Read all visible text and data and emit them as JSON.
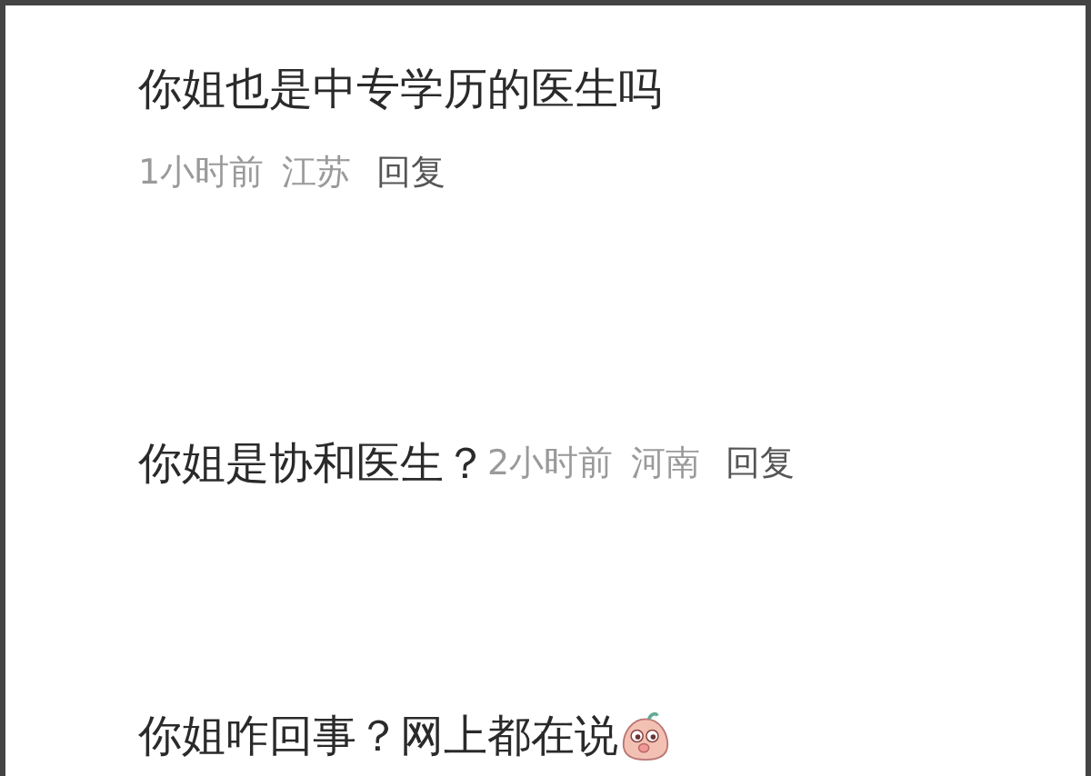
{
  "comments": [
    {
      "kind": "stacked",
      "text": "你姐也是中专学历的医生吗",
      "time": "1小时前",
      "location": "江苏",
      "reply": "回复",
      "emoji": false
    },
    {
      "kind": "inline",
      "text": "你姐是协和医生？",
      "time": "2小时前",
      "location": "河南",
      "reply": "回复",
      "emoji": false
    },
    {
      "kind": "plain",
      "text": "你姐咋回事？网上都在说",
      "emoji": true
    }
  ]
}
